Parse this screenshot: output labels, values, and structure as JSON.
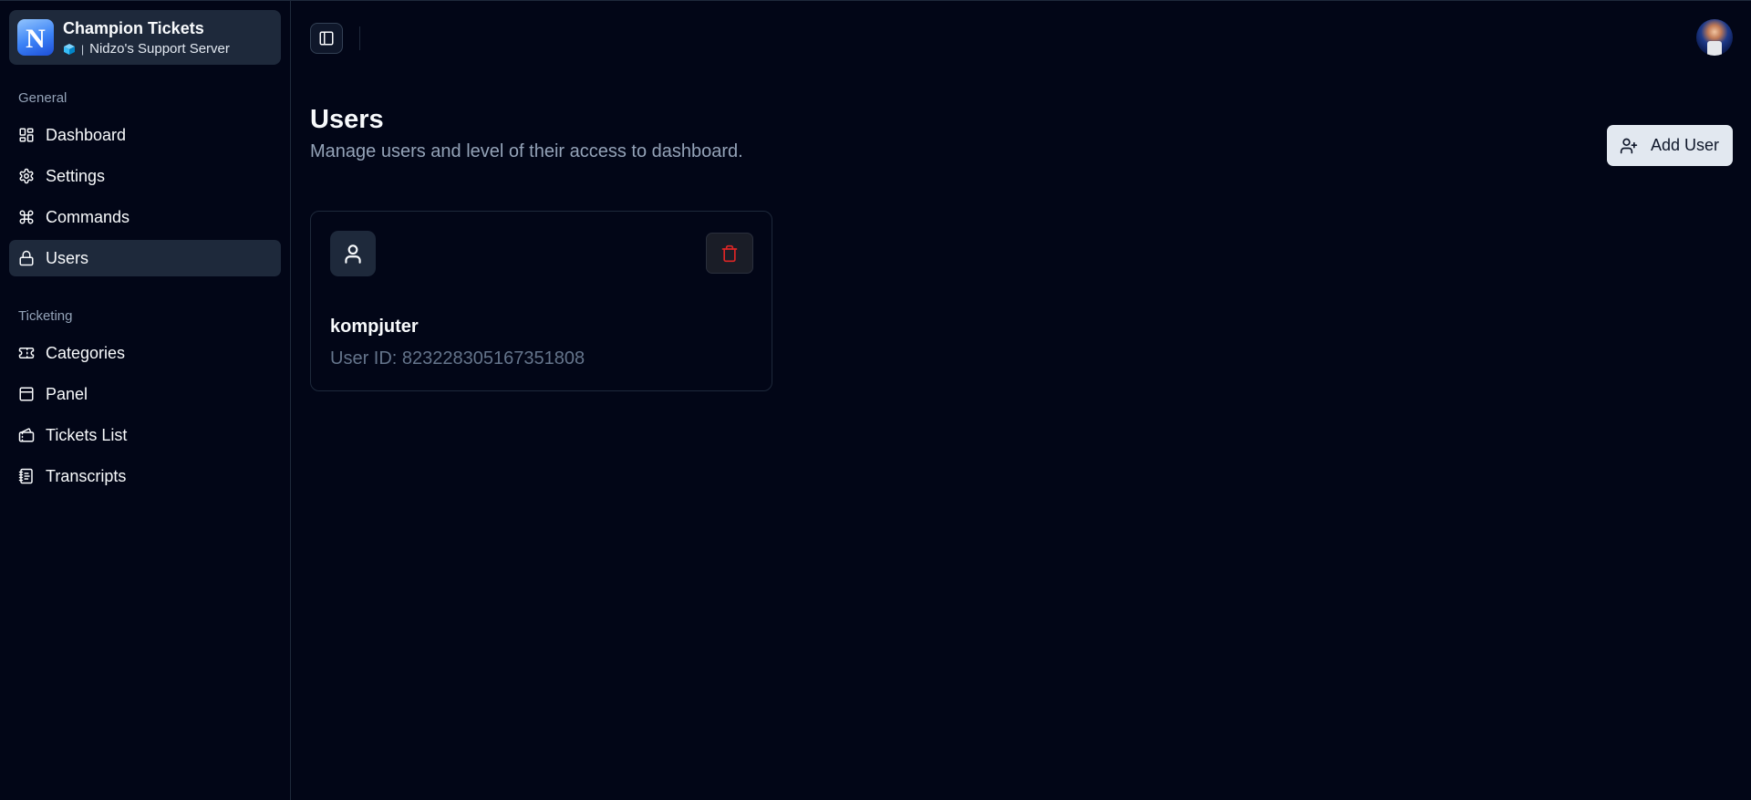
{
  "server": {
    "app_name": "Champion Tickets",
    "divider": "|",
    "server_name": "Nidzo's Support Server",
    "logo_letter": "N",
    "logo_icon": "n-logo-icon",
    "server_icon": "cube-icon"
  },
  "sidebar": {
    "general_label": "General",
    "general_items": [
      {
        "label": "Dashboard",
        "icon": "dashboard-icon"
      },
      {
        "label": "Settings",
        "icon": "gear-icon"
      },
      {
        "label": "Commands",
        "icon": "command-icon"
      },
      {
        "label": "Users",
        "icon": "lock-icon",
        "active": true
      }
    ],
    "ticketing_label": "Ticketing",
    "ticketing_items": [
      {
        "label": "Categories",
        "icon": "ticket-icon"
      },
      {
        "label": "Panel",
        "icon": "panel-icon"
      },
      {
        "label": "Tickets List",
        "icon": "tickets-list-icon"
      },
      {
        "label": "Transcripts",
        "icon": "notebook-icon"
      }
    ]
  },
  "header": {
    "toggle_icon": "sidebar-toggle-icon",
    "avatar_icon": "user-avatar"
  },
  "page": {
    "title": "Users",
    "subtitle": "Manage users and level of their access to dashboard.",
    "add_user_label": "Add User"
  },
  "users": [
    {
      "name": "kompjuter",
      "id_text": "User ID: 823228305167351808"
    }
  ],
  "colors": {
    "background": "#020617",
    "accent_surface": "#1e293b",
    "delete_red": "#dc2626",
    "muted_text": "#94a3b8"
  }
}
